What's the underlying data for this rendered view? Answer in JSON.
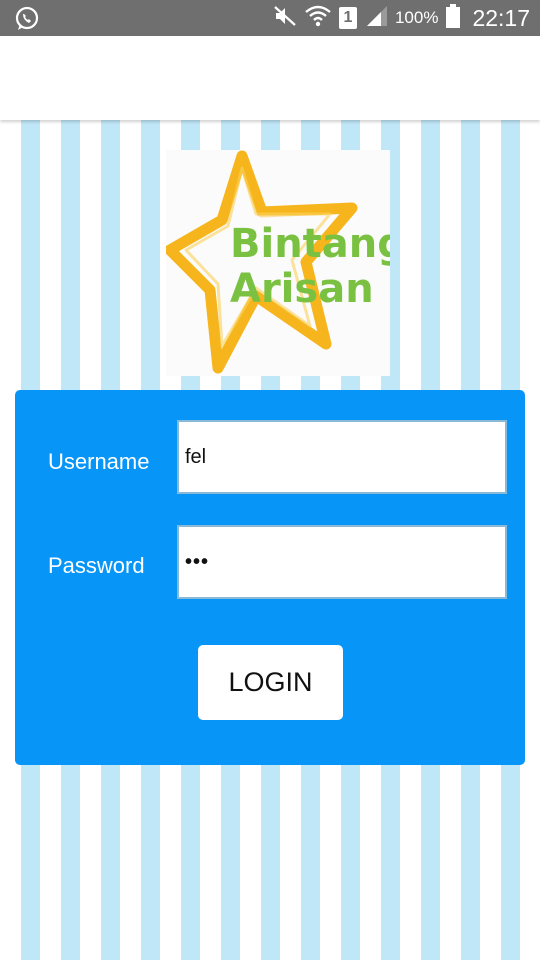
{
  "status_bar": {
    "notification_icon": "whatsapp-icon",
    "icons": [
      "mute-icon",
      "wifi-icon",
      "sim-icon",
      "signal-icon",
      "battery-icon"
    ],
    "sim_number": "1",
    "battery_percent": "100%",
    "time": "22:17"
  },
  "logo": {
    "line1": "Bintang",
    "line2": "Arisan",
    "star_color": "#f6b51c",
    "text_color": "#7ac142"
  },
  "login": {
    "username_label": "Username",
    "password_label": "Password",
    "username_value": "fel",
    "password_value": "•••",
    "button_label": "LOGIN"
  },
  "colors": {
    "panel": "#0796f7",
    "stripe": "#bfe7f7",
    "status_bar": "#6f6f6f"
  }
}
